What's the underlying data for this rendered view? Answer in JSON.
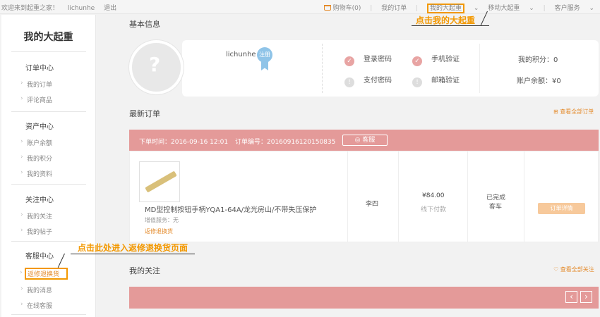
{
  "topbar": {
    "welcome": "欢迎来到起重之家！",
    "username": "lichunhe",
    "logout": "退出",
    "cart": "购物车(0)",
    "my_orders": "我的订单",
    "my_daqizhong": "我的大起重",
    "mobile": "移动大起重",
    "service": "客户服务"
  },
  "callouts": {
    "top": "点击我的大起重",
    "left": "点击此处进入返修退换货页面"
  },
  "sidebar": {
    "title": "我的大起重",
    "groups": [
      {
        "head": "订单中心",
        "items": [
          "我的订单",
          "评论商品"
        ]
      },
      {
        "head": "资产中心",
        "items": [
          "账户余额",
          "我的积分",
          "我的资料"
        ]
      },
      {
        "head": "关注中心",
        "items": [
          "我的关注",
          "我的帖子"
        ]
      },
      {
        "head": "客服中心",
        "items": [
          "返修退换货",
          "我的消息",
          "在线客服"
        ]
      }
    ]
  },
  "basic_info": {
    "title": "基本信息",
    "username": "lichunhe",
    "badge": "注册",
    "security": [
      {
        "label": "登录密码",
        "status": "ok"
      },
      {
        "label": "手机验证",
        "status": "ok"
      },
      {
        "label": "支付密码",
        "status": "warn"
      },
      {
        "label": "邮箱验证",
        "status": "warn"
      }
    ],
    "points": "我的积分：0",
    "balance": "账户余额：¥0"
  },
  "latest_orders": {
    "title": "最新订单",
    "view_all": "查看全部订单",
    "order_time": "下单时间：2016-09-16 12:01",
    "order_no": "订单编号：2016091612015083​5",
    "service_btn": "客服",
    "product_name": "MD型控制按钮手柄YQA1-64A/龙光房山/不带失压保护",
    "value_added": "增值服务：无",
    "return_link": "返修退换货",
    "buyer": "李四",
    "price": "¥84.00",
    "payment": "线下付款",
    "status": "已完成",
    "method": "客车",
    "detail_btn": "订单详情"
  },
  "follow": {
    "title": "我的关注",
    "view_all": "查看全部关注"
  }
}
